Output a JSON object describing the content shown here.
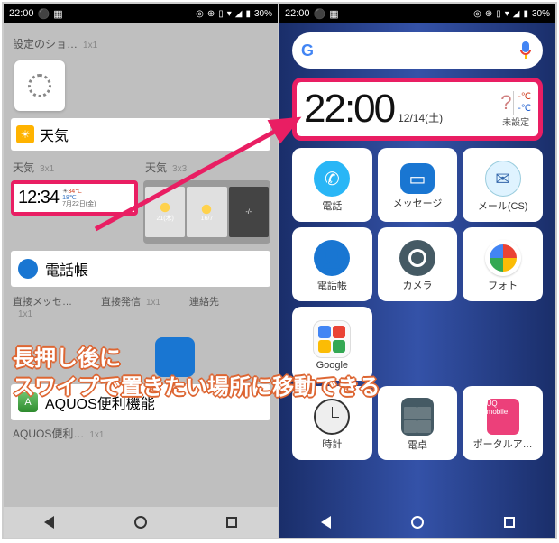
{
  "status": {
    "time": "22:00",
    "battery": "30%"
  },
  "left": {
    "settings_label": "設定のショ…",
    "settings_size": "1x1",
    "weather_app": "天気",
    "weather_3x1_label": "天気",
    "weather_3x1_size": "3x1",
    "weather_3x3_label": "天気",
    "weather_3x3_size": "3x3",
    "w31_time": "12:34",
    "w31_date": "7月22日(金)",
    "w31_high": "34℃",
    "w31_low": "18℃",
    "w33_d1": "21(木)",
    "w33_d2": "16/7",
    "w33_d3": "-/-",
    "contacts_app": "電話帳",
    "direct_msg": "直接メッセ…",
    "direct_msg_size": "1x1",
    "direct_call": "直接発信",
    "direct_call_size": "1x1",
    "contacts_col": "連絡先",
    "aquos_app": "AQUOS便利機能",
    "aquos_item": "AQUOS便利…",
    "aquos_item_size": "1x1"
  },
  "right": {
    "clock_time": "22:00",
    "clock_date": "12/14(土)",
    "temp_high": "-℃",
    "temp_low": "-℃",
    "unset": "未設定",
    "apps": {
      "phone": "電話",
      "message": "メッセージ",
      "mailcs": "メール(CS)",
      "contacts": "電話帳",
      "camera": "カメラ",
      "photos": "フォト",
      "clock": "時計",
      "calc": "電卓",
      "portal": "ポータルア…"
    },
    "google_label": "Google"
  },
  "caption": {
    "line1": "長押し後に",
    "line2": "スワイプで置きたい場所に移動できる"
  }
}
